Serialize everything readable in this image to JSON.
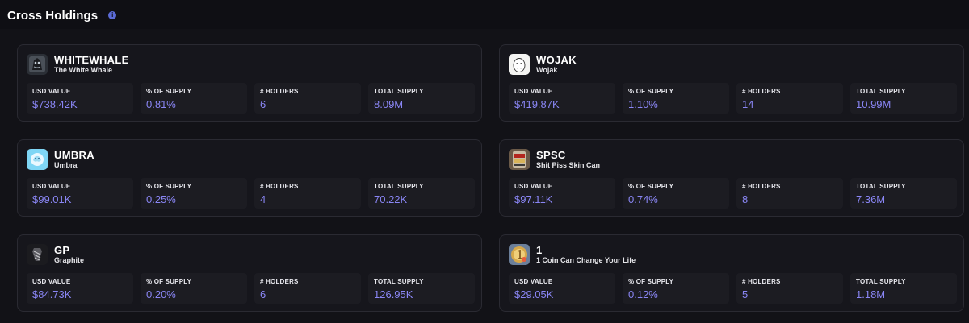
{
  "header": {
    "title": "Cross Holdings",
    "info_icon": "info-icon"
  },
  "labels": {
    "usd_value": "USD VALUE",
    "pct_supply": "% OF SUPPLY",
    "holders": "# HOLDERS",
    "total_supply": "TOTAL SUPPLY"
  },
  "colors": {
    "accent": "#8a86f5",
    "background": "#0f0f14",
    "card": "#16161c",
    "info": "#5b6bd6"
  },
  "holdings": [
    {
      "symbol": "WHITEWHALE",
      "name": "The White Whale",
      "icon": "whale-token-icon",
      "usd_value": "$738.42K",
      "pct_supply": "0.81%",
      "holders": "6",
      "total_supply": "8.09M"
    },
    {
      "symbol": "WOJAK",
      "name": "Wojak",
      "icon": "wojak-token-icon",
      "usd_value": "$419.87K",
      "pct_supply": "1.10%",
      "holders": "14",
      "total_supply": "10.99M"
    },
    {
      "symbol": "UMBRA",
      "name": "Umbra",
      "icon": "umbra-token-icon",
      "usd_value": "$99.01K",
      "pct_supply": "0.25%",
      "holders": "4",
      "total_supply": "70.22K"
    },
    {
      "symbol": "SPSC",
      "name": "Shit Piss Skin Can",
      "icon": "spsc-token-icon",
      "usd_value": "$97.11K",
      "pct_supply": "0.74%",
      "holders": "8",
      "total_supply": "7.36M"
    },
    {
      "symbol": "GP",
      "name": "Graphite",
      "icon": "graphite-token-icon",
      "usd_value": "$84.73K",
      "pct_supply": "0.20%",
      "holders": "6",
      "total_supply": "126.95K"
    },
    {
      "symbol": "1",
      "name": "1 Coin Can Change Your Life",
      "icon": "one-coin-token-icon",
      "usd_value": "$29.05K",
      "pct_supply": "0.12%",
      "holders": "5",
      "total_supply": "1.18M"
    }
  ]
}
